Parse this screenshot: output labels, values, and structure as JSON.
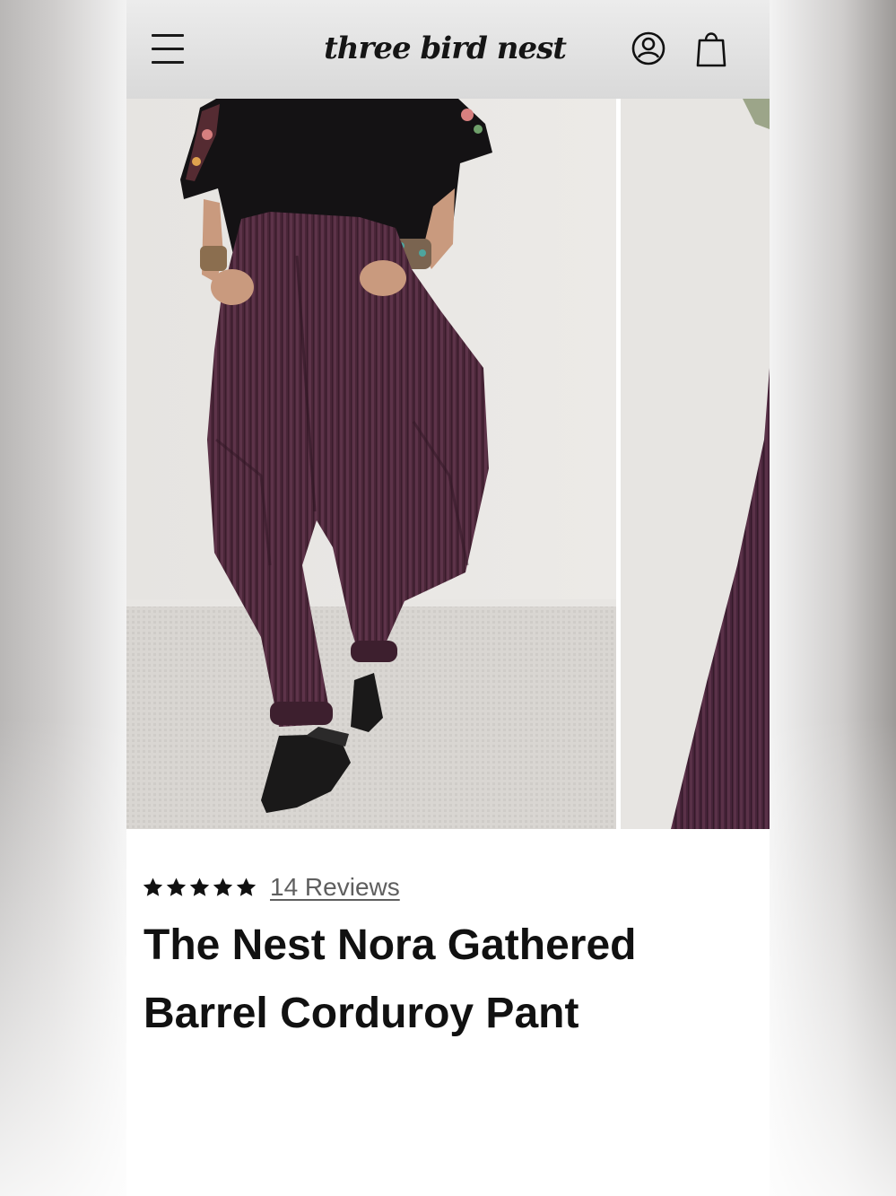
{
  "header": {
    "logo_text": "three bird nest",
    "menu_icon": "hamburger-menu-icon",
    "account_icon": "user-account-icon",
    "cart_icon": "shopping-bag-icon"
  },
  "gallery": {
    "images": [
      {
        "name": "model-wearing-purple-corduroy-barrel-pants"
      },
      {
        "name": "pant-detail-close-up"
      }
    ]
  },
  "product": {
    "rating": 5,
    "reviews_label": "14 Reviews",
    "title": "The Nest Nora Gathered Barrel Corduroy Pant"
  },
  "colors": {
    "header_bg": "#e3e3e3",
    "text": "#111111",
    "link": "#5f5f5f",
    "pant_color": "#4a2638"
  }
}
